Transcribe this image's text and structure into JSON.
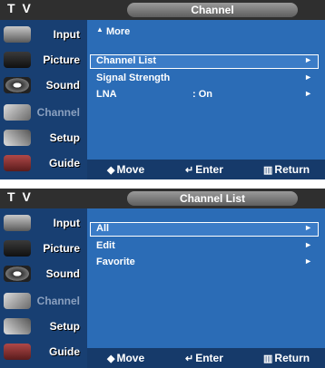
{
  "panels": [
    {
      "tv_label": "T V",
      "title": "Channel",
      "sidebar": [
        {
          "label": "Input",
          "icon": "input-icon"
        },
        {
          "label": "Picture",
          "icon": "picture-icon"
        },
        {
          "label": "Sound",
          "icon": "sound-icon"
        },
        {
          "label": "Channel",
          "icon": "channel-icon",
          "active": true
        },
        {
          "label": "Setup",
          "icon": "setup-icon"
        },
        {
          "label": "Guide",
          "icon": "guide-icon"
        }
      ],
      "more_label": "More",
      "rows": [
        {
          "label": "Channel List",
          "value": "",
          "arrow": "►",
          "selected": true
        },
        {
          "label": "Signal Strength",
          "value": "",
          "arrow": "►"
        },
        {
          "label": "LNA",
          "value": ": On",
          "arrow": "►"
        }
      ],
      "footer": {
        "move": "Move",
        "enter": "Enter",
        "return": "Return"
      }
    },
    {
      "tv_label": "T V",
      "title": "Channel List",
      "sidebar": [
        {
          "label": "Input",
          "icon": "input-icon"
        },
        {
          "label": "Picture",
          "icon": "picture-icon"
        },
        {
          "label": "Sound",
          "icon": "sound-icon"
        },
        {
          "label": "Channel",
          "icon": "channel-icon",
          "active": true
        },
        {
          "label": "Setup",
          "icon": "setup-icon"
        },
        {
          "label": "Guide",
          "icon": "guide-icon"
        }
      ],
      "rows": [
        {
          "label": "All",
          "value": "",
          "arrow": "►",
          "selected": true
        },
        {
          "label": "Edit",
          "value": "",
          "arrow": "►"
        },
        {
          "label": "Favorite",
          "value": "",
          "arrow": "►"
        }
      ],
      "footer": {
        "move": "Move",
        "enter": "Enter",
        "return": "Return"
      }
    }
  ],
  "colors": {
    "panel_bg": "#1f5fa8",
    "sidebar_bg": "#183f72",
    "header_bg": "#2f2f2f"
  }
}
